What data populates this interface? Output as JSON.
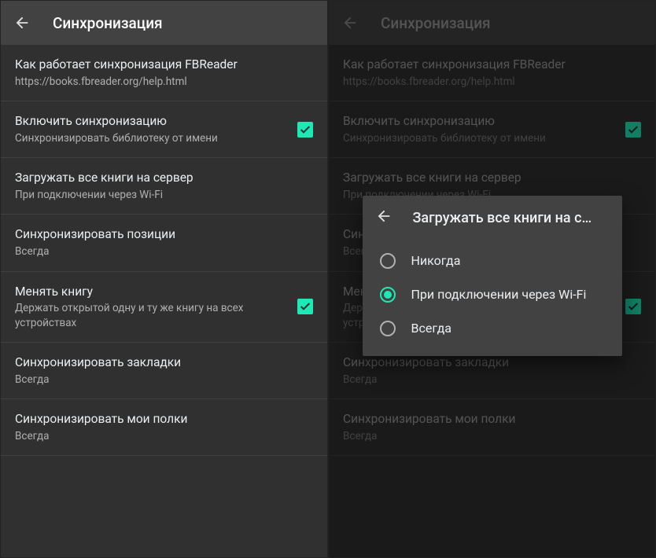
{
  "left": {
    "title": "Синхронизация",
    "items": [
      {
        "primary": "Как работает синхронизация FBReader",
        "secondary": "https://books.fbreader.org/help.html",
        "checkbox": false
      },
      {
        "primary": "Включить синхронизацию",
        "secondary": "Синхронизировать библиотеку от имени",
        "checkbox": true,
        "checked": true
      },
      {
        "primary": "Загружать все книги на сервер",
        "secondary": "При подключении через Wi-Fi",
        "checkbox": false
      },
      {
        "primary": "Синхронизировать позиции",
        "secondary": "Всегда",
        "checkbox": false
      },
      {
        "primary": "Менять книгу",
        "secondary": "Держать открытой одну и ту же книгу на всех устройствах",
        "checkbox": true,
        "checked": true
      },
      {
        "primary": "Синхронизировать закладки",
        "secondary": "Всегда",
        "checkbox": false
      },
      {
        "primary": "Синхронизировать мои полки",
        "secondary": "Всегда",
        "checkbox": false
      }
    ]
  },
  "right": {
    "title": "Синхронизация",
    "items": [
      {
        "primary": "Как работает синхронизация FBReader",
        "secondary": "https://books.fbreader.org/help.html",
        "checkbox": false
      },
      {
        "primary": "Включить синхронизацию",
        "secondary": "Синхронизировать библиотеку от имени",
        "checkbox": true,
        "checked": true
      },
      {
        "primary": "Загружать все книги на сервер",
        "secondary": "При подключении через Wi-Fi",
        "checkbox": false
      },
      {
        "primary": "Синхронизировать позиции",
        "secondary": "Всегда",
        "checkbox": false
      },
      {
        "primary": "Менять книгу",
        "secondary": "Держать открытой одну и ту же книгу на всех устройствах",
        "checkbox": true,
        "checked": true
      },
      {
        "primary": "Синхронизировать закладки",
        "secondary": "Всегда",
        "checkbox": false
      },
      {
        "primary": "Синхронизировать мои полки",
        "secondary": "Всегда",
        "checkbox": false
      }
    ]
  },
  "dialog": {
    "title": "Загружать все книги на с…",
    "options": [
      {
        "label": "Никогда",
        "selected": false
      },
      {
        "label": "При подключении через Wi-Fi",
        "selected": true
      },
      {
        "label": "Всегда",
        "selected": false
      }
    ]
  }
}
